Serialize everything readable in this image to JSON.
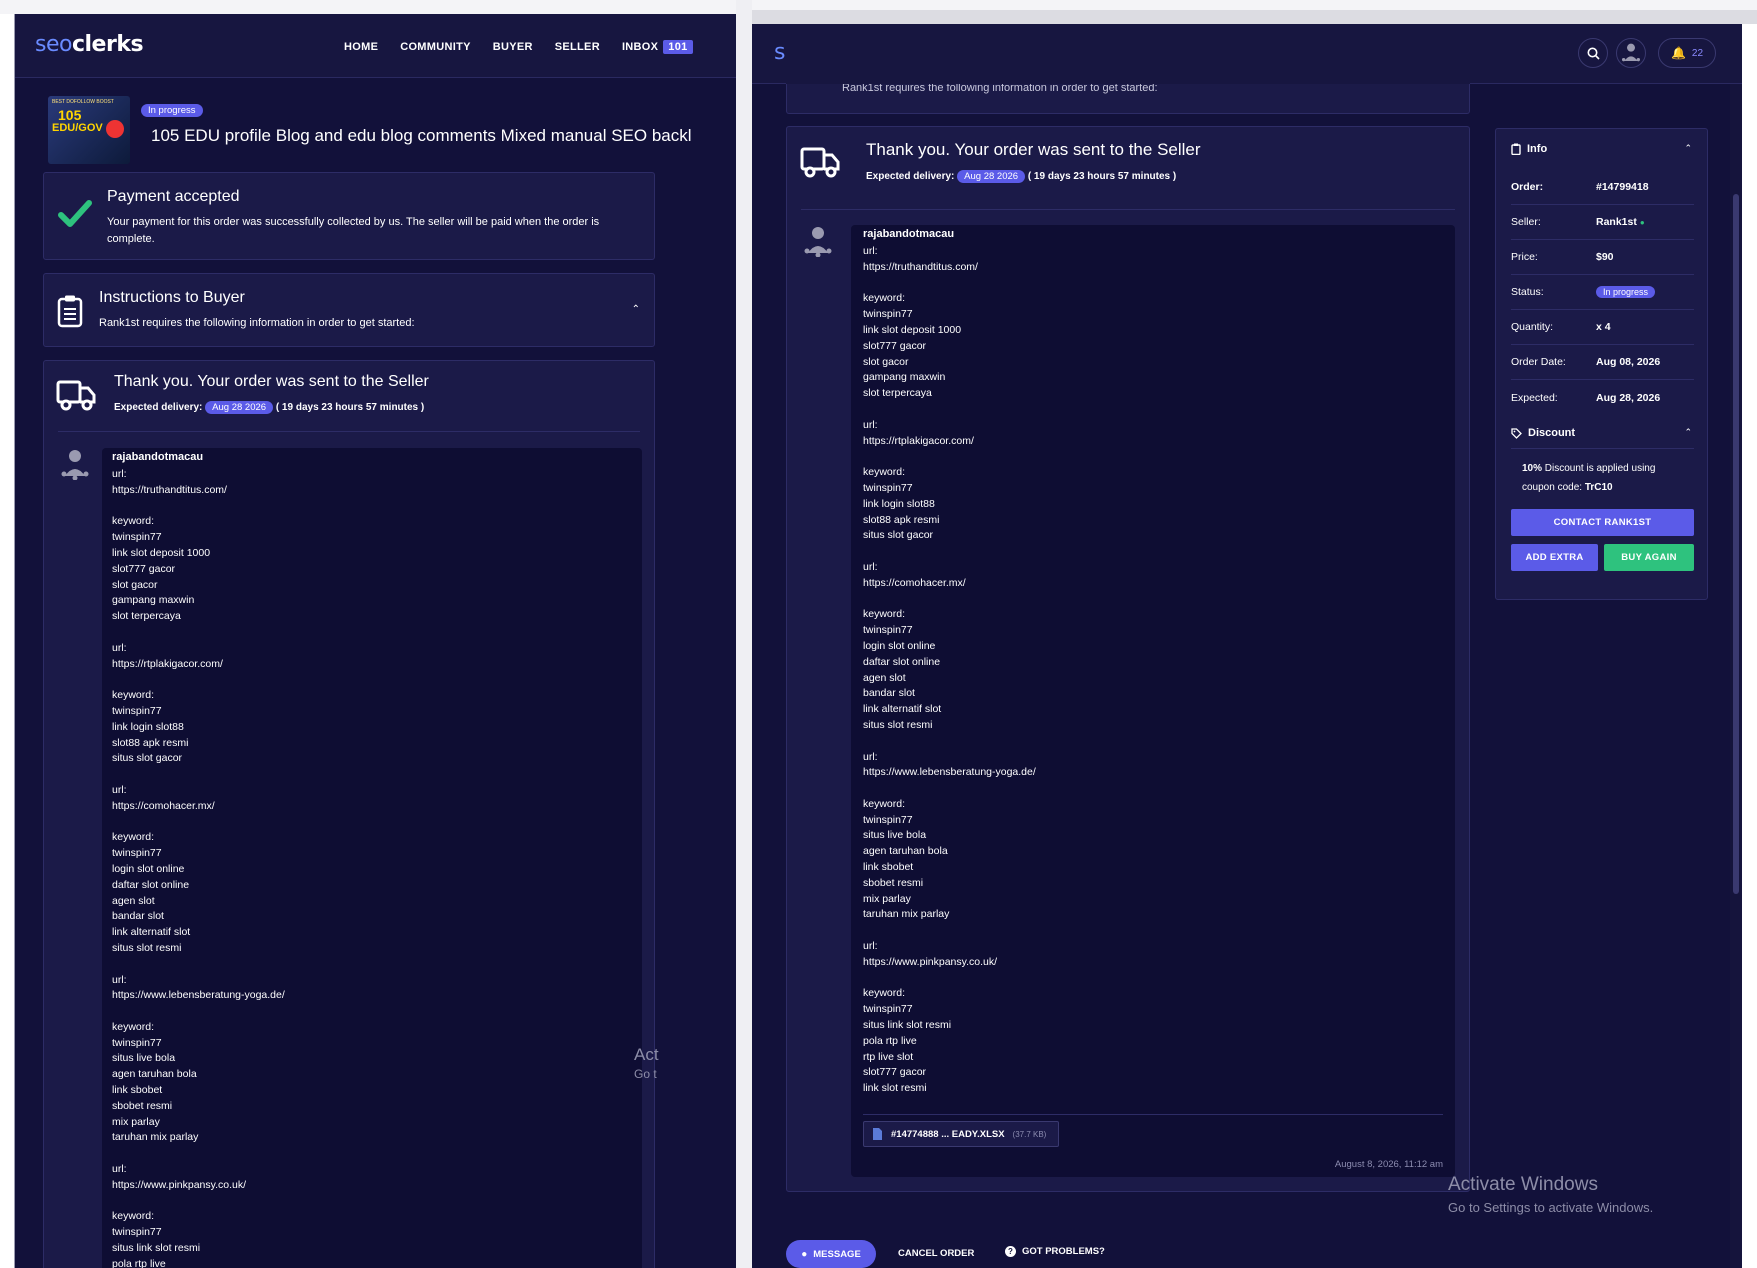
{
  "brand": {
    "seo": "seo",
    "clerks": "clerks"
  },
  "nav": {
    "home": "HOME",
    "community": "COMMUNITY",
    "buyer": "BUYER",
    "seller": "SELLER",
    "inbox": "INBOX",
    "inbox_count": "101",
    "notif_count": "22"
  },
  "order_header": {
    "status_pill": "In progress",
    "title": "105 EDU profile Blog and edu blog comments Mixed manual SEO backl",
    "thumb_line1": "BEST DOFOLLOW BOOST",
    "thumb_big": "105",
    "thumb_line2": "EDU/GOV"
  },
  "payment": {
    "title": "Payment accepted",
    "text": "Your payment for this order was successfully collected by us. The seller will be paid when the order is complete."
  },
  "instructions": {
    "title": "Instructions to Buyer",
    "text": "Rank1st requires the following information in order to get started:"
  },
  "sent": {
    "title": "Thank you. Your order was sent to the Seller",
    "expected_label": "Expected delivery:",
    "date_pill": "Aug 28 2026",
    "remaining": "( 19 days 23 hours 57 minutes )"
  },
  "message": {
    "sender": "rajabandotmacau",
    "lines": [
      "url:",
      "https://truthandtitus.com/",
      "",
      "keyword:",
      "twinspin77",
      "link slot deposit 1000",
      "slot777 gacor",
      "slot gacor",
      "gampang maxwin",
      "slot terpercaya",
      "",
      "url:",
      "https://rtplakigacor.com/",
      "",
      "keyword:",
      "twinspin77",
      "link login slot88",
      "slot88 apk resmi",
      "situs slot gacor",
      "",
      "url:",
      "https://comohacer.mx/",
      "",
      "keyword:",
      "twinspin77",
      "login slot online",
      "daftar slot online",
      "agen slot",
      "bandar slot",
      "link alternatif slot",
      "situs slot resmi",
      "",
      "url:",
      "https://www.lebensberatung-yoga.de/",
      "",
      "keyword:",
      "twinspin77",
      "situs live bola",
      "agen taruhan bola",
      "link sbobet",
      "sbobet resmi",
      "mix parlay",
      "taruhan mix parlay",
      "",
      "url:",
      "https://www.pinkpansy.co.uk/",
      "",
      "keyword:",
      "twinspin77",
      "situs link slot resmi",
      "pola rtp live",
      "rtp live slot",
      "slot777 gacor",
      "link slot resmi"
    ],
    "attachment_name": "#14774888 ... EADY.XLSX",
    "attachment_size": "(37.7 KB)",
    "timestamp": "August 8, 2026, 11:12 am"
  },
  "info": {
    "title": "Info",
    "rows": [
      {
        "key": "Order:",
        "value": "#14799418"
      },
      {
        "key": "Seller:",
        "value": "Rank1st"
      },
      {
        "key": "Price:",
        "value": "$90"
      },
      {
        "key": "Status:",
        "value": "In progress"
      },
      {
        "key": "Quantity:",
        "value": "x 4"
      },
      {
        "key": "Order Date:",
        "value": "Aug 08, 2026"
      },
      {
        "key": "Expected:",
        "value": "Aug 28, 2026"
      }
    ]
  },
  "discount": {
    "title": "Discount",
    "percent": "10%",
    "text1": " Discount is applied using",
    "text2": "coupon code: ",
    "code": "TrC10"
  },
  "buttons": {
    "contact": "CONTACT RANK1ST",
    "add_extra": "ADD EXTRA",
    "buy_again": "BUY AGAIN",
    "message": "MESSAGE",
    "cancel": "CANCEL ORDER",
    "problems": "GOT PROBLEMS?"
  },
  "watermark": {
    "title": "Activate Windows",
    "sub": "Go to Settings to activate Windows.",
    "left_title": "Act",
    "left_sub": "Go t"
  },
  "colors": {
    "accent": "#5b5be8",
    "success": "#2ec27e",
    "background": "#12113a"
  }
}
